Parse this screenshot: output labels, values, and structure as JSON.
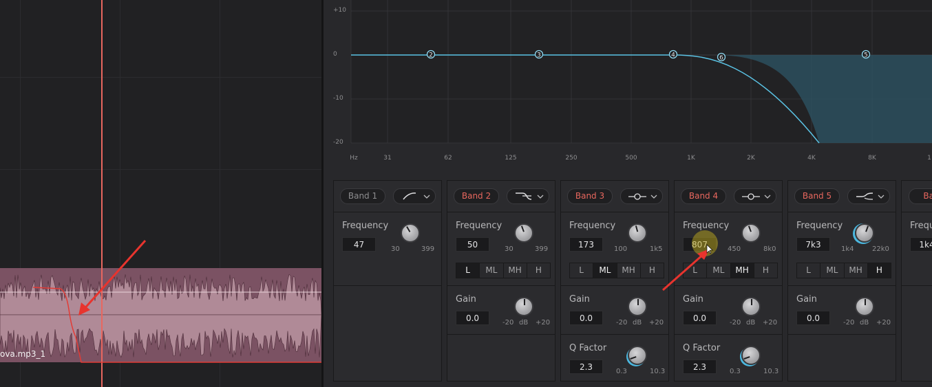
{
  "timeline": {
    "clip_label": "ova.mp3_1"
  },
  "eq_graph": {
    "db_labels": [
      "+10",
      "0",
      "-10",
      "-20"
    ],
    "hz_labels": [
      "Hz",
      "31",
      "62",
      "125",
      "250",
      "500",
      "1K",
      "2K",
      "4K",
      "8K",
      "1"
    ],
    "node_labels": [
      "2",
      "3",
      "4",
      "6",
      "5"
    ],
    "curve_color": "#5bc4e6"
  },
  "bands": [
    {
      "name": "Band 1",
      "filter_icon": "high-pass-icon",
      "freq_label": "Frequency",
      "freq_value": "47",
      "freq_min": "30",
      "freq_max": "399",
      "enabled": false
    },
    {
      "name": "Band 2",
      "filter_icon": "low-shelf-icon",
      "freq_label": "Frequency",
      "freq_value": "50",
      "freq_min": "30",
      "freq_max": "399",
      "range": [
        "L",
        "ML",
        "MH",
        "H"
      ],
      "range_selected": "L",
      "gain_label": "Gain",
      "gain_value": "0.0",
      "gain_min": "-20",
      "gain_unit": "dB",
      "gain_max": "+20"
    },
    {
      "name": "Band 3",
      "filter_icon": "bell-icon",
      "freq_label": "Frequency",
      "freq_value": "173",
      "freq_min": "100",
      "freq_max": "1k5",
      "range": [
        "L",
        "ML",
        "MH",
        "H"
      ],
      "range_selected": "ML",
      "gain_label": "Gain",
      "gain_value": "0.0",
      "gain_min": "-20",
      "gain_unit": "dB",
      "gain_max": "+20",
      "q_label": "Q Factor",
      "q_value": "2.3",
      "q_min": "0.3",
      "q_max": "10.3"
    },
    {
      "name": "Band 4",
      "filter_icon": "bell-icon",
      "freq_label": "Frequency",
      "freq_value": "807",
      "freq_min": "450",
      "freq_max": "8k0",
      "range": [
        "L",
        "ML",
        "MH",
        "H"
      ],
      "range_selected": "MH",
      "gain_label": "Gain",
      "gain_value": "0.0",
      "gain_min": "-20",
      "gain_unit": "dB",
      "gain_max": "+20",
      "q_label": "Q Factor",
      "q_value": "2.3",
      "q_min": "0.3",
      "q_max": "10.3"
    },
    {
      "name": "Band 5",
      "filter_icon": "high-shelf-icon",
      "freq_label": "Frequency",
      "freq_value": "7k3",
      "freq_min": "1k4",
      "freq_max": "22k0",
      "range": [
        "L",
        "ML",
        "MH",
        "H"
      ],
      "range_selected": "H",
      "gain_label": "Gain",
      "gain_value": "0.0",
      "gain_min": "-20",
      "gain_unit": "dB",
      "gain_max": "+20"
    },
    {
      "name": "Ban",
      "freq_label": "Frequ",
      "freq_value": "1k4"
    }
  ],
  "colors": {
    "accent_red": "#e8675e",
    "accent_blue": "#5bc4e6",
    "clip_fill": "#a57f8b"
  }
}
